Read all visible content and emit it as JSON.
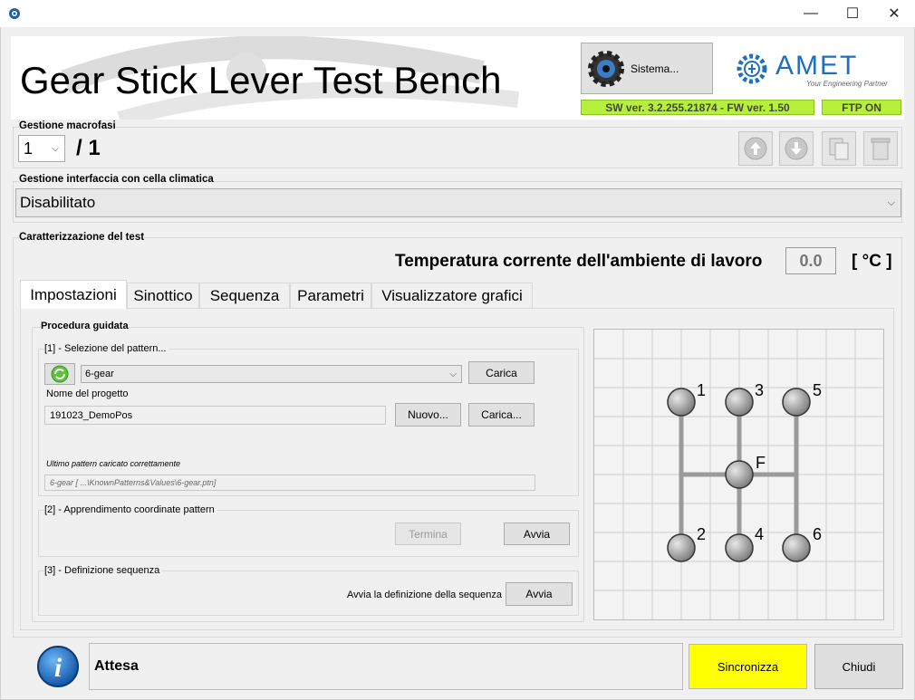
{
  "window": {
    "minimize": "—",
    "maximize": "☐",
    "close": "✕"
  },
  "header": {
    "title": "Gear Stick Lever Test Bench",
    "system_button": "Sistema...",
    "brand": "AMET",
    "brand_tagline": "Your Engineering Partner",
    "version": "SW ver. 3.2.255.21874 - FW ver. 1.50",
    "ftp_status": "FTP ON",
    "ftp_color": "#b6f03a"
  },
  "macrofasi": {
    "label": "Gestione macrofasi",
    "selected": "1",
    "total": "/ 1"
  },
  "cella": {
    "label": "Gestione interfaccia con cella climatica",
    "selected": "Disabilitato"
  },
  "test": {
    "label": "Caratterizzazione del test",
    "temp_label": "Temperatura corrente dell'ambiente di lavoro",
    "temp_value": "0.0",
    "temp_unit": "[ °C ]"
  },
  "tabs": [
    "Impostazioni",
    "Sinottico",
    "Sequenza",
    "Parametri",
    "Visualizzatore grafici"
  ],
  "procedura": {
    "label": "Procedura guidata",
    "step1": {
      "label": "[1] - Selezione del pattern...",
      "pattern": "6-gear",
      "load_button": "Carica",
      "project_label": "Nome del progetto",
      "project_value": "191023_DemoPos",
      "new_button": "Nuovo...",
      "load_project_button": "Carica...",
      "last_label": "Ultimo pattern caricato correttamente",
      "last_value": "6-gear  [ ...\\KnownPatterns&Values\\6-gear.ptn]"
    },
    "step2": {
      "label": "[2] - Apprendimento coordinate pattern",
      "stop_button": "Termina",
      "start_button": "Avvia"
    },
    "step3": {
      "label": "[3] - Definizione sequenza",
      "text": "Avvia la definizione della sequenza",
      "start_button": "Avvia"
    }
  },
  "gears": {
    "g1": "1",
    "g2": "2",
    "g3": "3",
    "g4": "4",
    "g5": "5",
    "g6": "6",
    "neutral": "F"
  },
  "status": {
    "text": "Attesa",
    "sync_button": "Sincronizza",
    "sync_color": "#ffff00",
    "close_button": "Chiudi"
  },
  "icons": [
    "app-gear-icon",
    "gear-settings-icon",
    "amet-logo-icon",
    "arrow-up-icon",
    "arrow-down-icon",
    "copy-icon",
    "trash-icon",
    "refresh-icon",
    "info-icon"
  ]
}
